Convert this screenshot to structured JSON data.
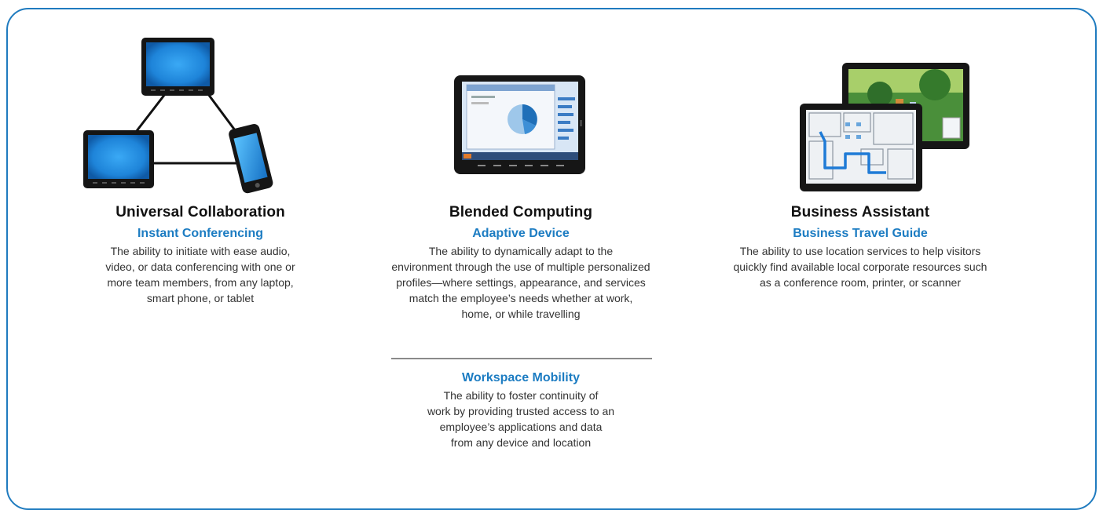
{
  "columns": [
    {
      "title": "Universal Collaboration",
      "icon": "connected-devices-illustration",
      "items": [
        {
          "subtitle": "Instant Conferencing",
          "lines": [
            "The ability to initiate with ease audio,",
            "video, or data conferencing with one or",
            "more team members, from any laptop,",
            "smart phone, or tablet"
          ]
        }
      ]
    },
    {
      "title": "Blended Computing",
      "icon": "tablet-dashboard-illustration",
      "items": [
        {
          "subtitle": "Adaptive Device",
          "lines": [
            "The ability to dynamically adapt to the",
            "environment through the use of multiple personalized",
            "profiles—where settings, appearance, and services",
            "match the  employee’s needs whether at work,",
            "home, or while travelling"
          ]
        },
        {
          "subtitle": "Workspace Mobility",
          "lines": [
            "The ability to foster continuity of",
            "work by providing trusted access to an",
            "employee’s applications and data",
            "from any device and location"
          ]
        }
      ]
    },
    {
      "title": "Business Assistant",
      "icon": "tablet-map-illustration",
      "items": [
        {
          "subtitle": "Business Travel Guide",
          "lines": [
            "The ability to use location services to help visitors",
            "quickly find available local corporate resources such",
            "as a conference room, printer, or scanner"
          ]
        }
      ]
    }
  ],
  "colors": {
    "frame": "#1f7bbf",
    "subtitle": "#1c7cc2",
    "divider": "#8a8a8a"
  }
}
